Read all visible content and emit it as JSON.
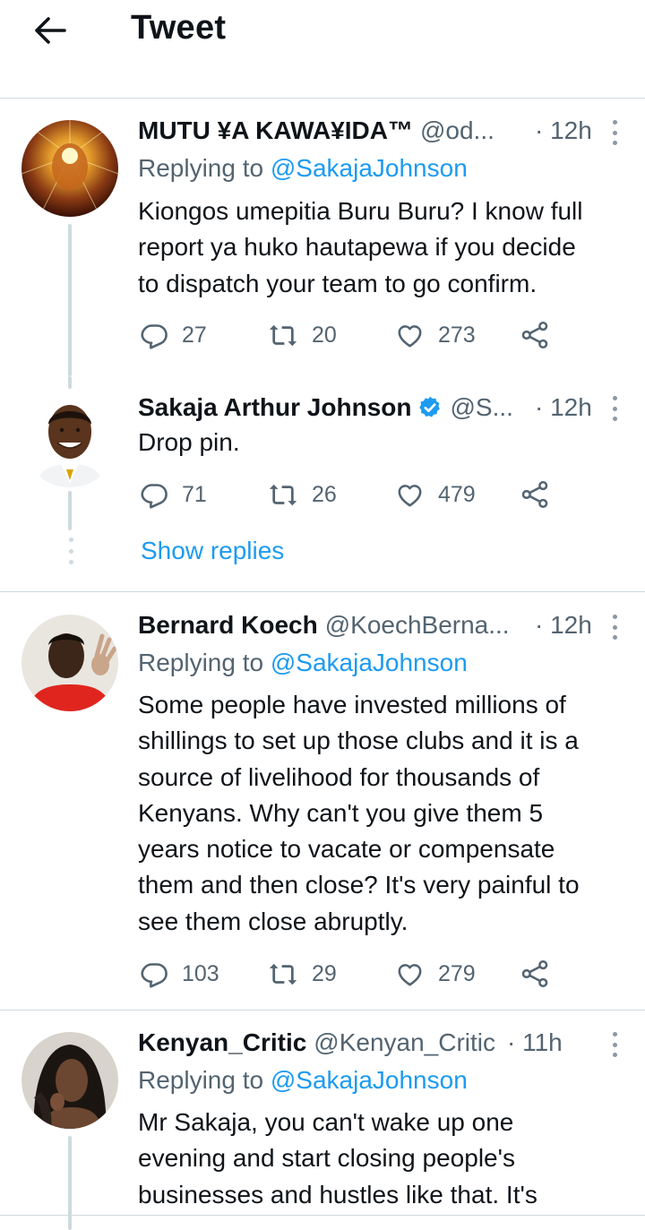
{
  "header": {
    "title": "Tweet",
    "back_icon": "arrow-left-icon"
  },
  "tweets": [
    {
      "name": "MUTU ¥A KAWA¥IDA™",
      "handle": "@od...",
      "time": "· 12h",
      "replying_prefix": "Replying to",
      "replying_to": "@SakajaJohnson",
      "text": "Kiongos umepitia Buru Buru? I know full\nreport ya huko hautapewa if you decide\nto dispatch your team to go confirm.",
      "replies": "27",
      "retweets": "20",
      "likes": "273"
    },
    {
      "name": "Sakaja Arthur Johnson",
      "verified": true,
      "handle": "@S...",
      "time": "· 12h",
      "text": "Drop pin.",
      "replies": "71",
      "retweets": "26",
      "likes": "479",
      "show_replies": "Show replies"
    },
    {
      "name": "Bernard Koech",
      "handle": "@KoechBerna...",
      "time": "· 12h",
      "replying_prefix": "Replying to",
      "replying_to": "@SakajaJohnson",
      "text": "Some people have invested millions of\nshillings to set up those clubs and it is a\nsource of livelihood for thousands of\nKenyans. Why can't you give them 5\nyears notice to vacate or compensate\nthem and then close? It's very painful to\nsee them close abruptly.",
      "replies": "103",
      "retweets": "29",
      "likes": "279"
    },
    {
      "name": "Kenyan_Critic",
      "handle": "@Kenyan_Critic",
      "time": "· 11h",
      "replying_prefix": "Replying to",
      "replying_to": "@SakajaJohnson",
      "text": "Mr Sakaja, you can't wake up one\nevening and start closing people's\nbusinesses and hustles like that. It's"
    }
  ],
  "colors": {
    "accent": "#1d9bf0",
    "muted": "#536471",
    "border": "#cfd9de"
  },
  "icons": [
    "reply-icon",
    "retweet-icon",
    "like-icon",
    "share-icon",
    "more-icon",
    "verified-badge-icon"
  ]
}
